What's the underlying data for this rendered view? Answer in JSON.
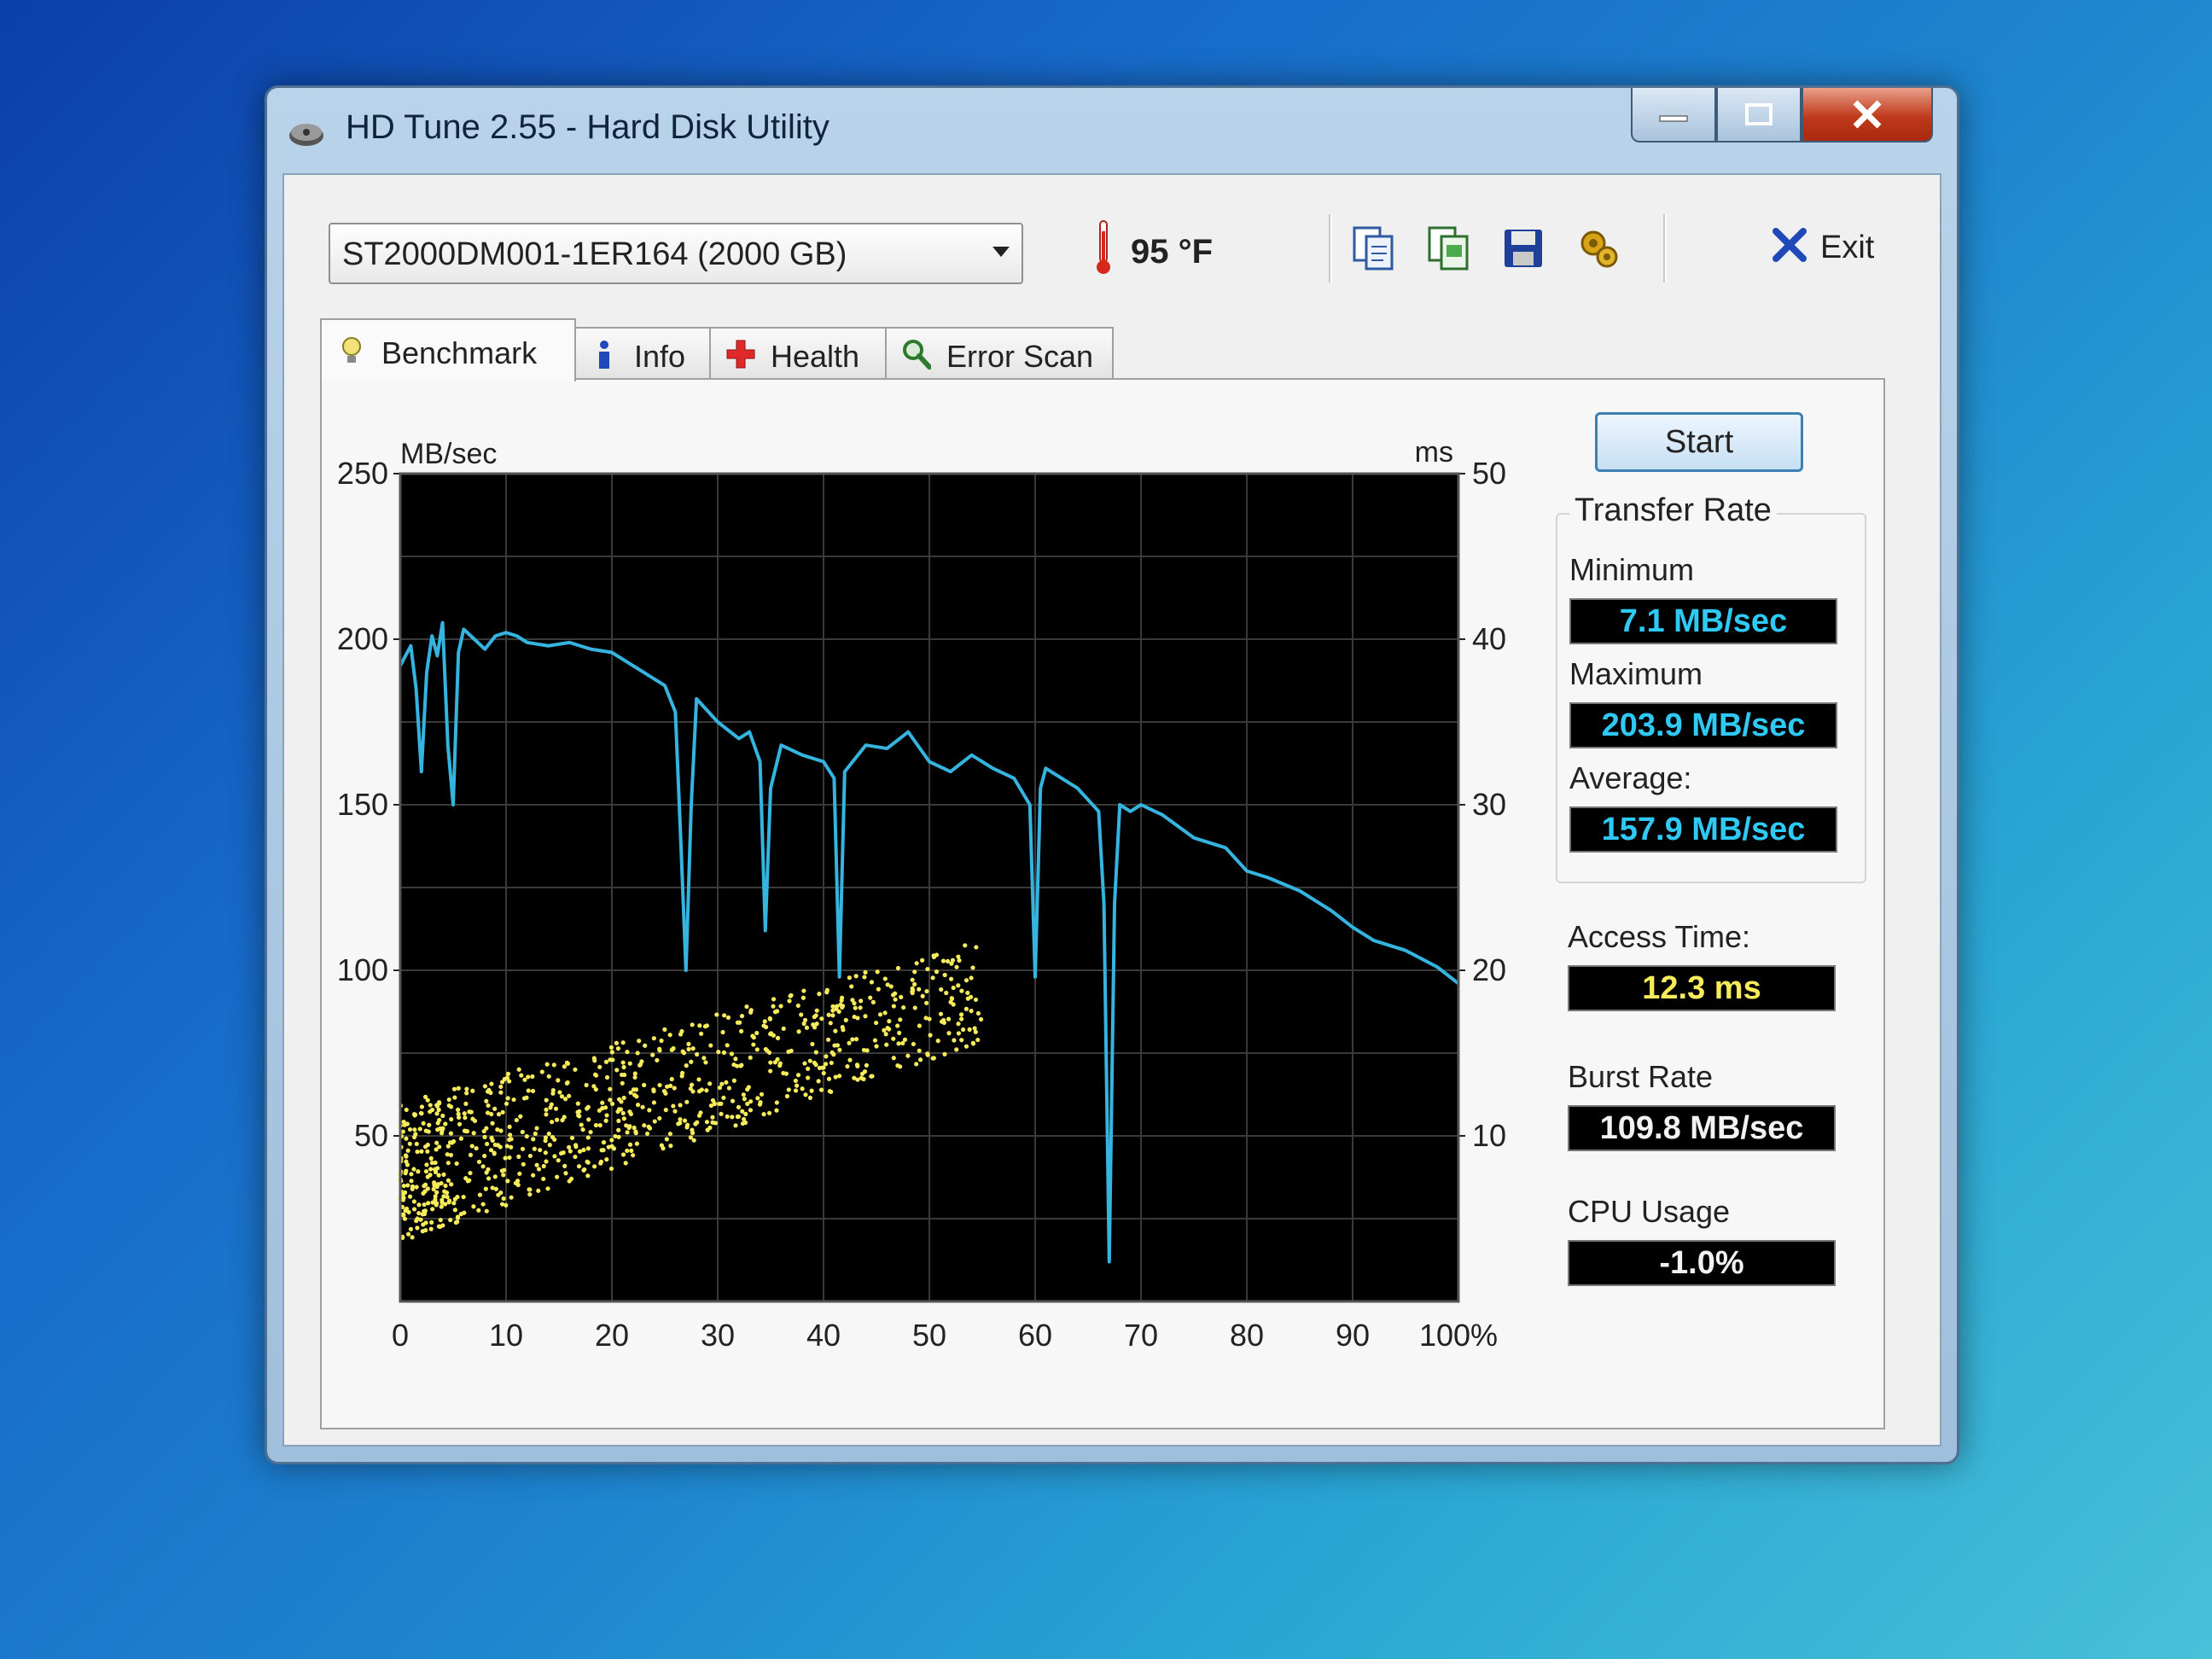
{
  "window": {
    "title": "HD Tune 2.55 - Hard Disk Utility"
  },
  "toolbar": {
    "drive": "ST2000DM001-1ER164 (2000 GB)",
    "temperature": "95 °F",
    "icons": [
      "copy-text-icon",
      "copy-screenshot-icon",
      "save-icon",
      "options-icon"
    ],
    "exit_label": "Exit"
  },
  "tabs": [
    {
      "label": "Benchmark",
      "icon": "lightbulb-icon",
      "active": true
    },
    {
      "label": "Info",
      "icon": "info-icon",
      "active": false
    },
    {
      "label": "Health",
      "icon": "health-cross-icon",
      "active": false
    },
    {
      "label": "Error Scan",
      "icon": "magnifier-icon",
      "active": false
    }
  ],
  "colors": {
    "transfer_line": "#35b4e0",
    "access_points": "#f6ec5b",
    "plot_bg": "#000000",
    "grid": "#3a3a3a"
  },
  "side": {
    "start_label": "Start",
    "transfer_rate_title": "Transfer Rate",
    "minimum_label": "Minimum",
    "minimum_value": "7.1 MB/sec",
    "maximum_label": "Maximum",
    "maximum_value": "203.9 MB/sec",
    "average_label": "Average:",
    "average_value": "157.9 MB/sec",
    "access_time_label": "Access Time:",
    "access_time_value": "12.3 ms",
    "burst_rate_label": "Burst Rate",
    "burst_rate_value": "109.8 MB/sec",
    "cpu_usage_label": "CPU Usage",
    "cpu_usage_value": "-1.0%"
  },
  "chart_data": {
    "type": "line",
    "grid": true,
    "y_left_unit": "MB/sec",
    "y_right_unit": "ms",
    "ylim": [
      0,
      250
    ],
    "y2lim": [
      0,
      50
    ],
    "y_ticks": [
      "250",
      "200",
      "150",
      "100",
      "50"
    ],
    "y2_ticks": [
      "50",
      "40",
      "30",
      "20",
      "10"
    ],
    "x_ticks": [
      "0",
      "10",
      "20",
      "30",
      "40",
      "50",
      "60",
      "70",
      "80",
      "90",
      "100%"
    ],
    "transfer_rate": {
      "x": [
        0,
        1,
        1.5,
        2,
        2.5,
        3,
        3.5,
        4,
        4.5,
        5,
        5.5,
        6,
        7,
        8,
        9,
        10,
        11,
        12,
        14,
        16,
        18,
        20,
        22,
        24,
        25,
        26,
        26.5,
        27,
        27.5,
        28,
        30,
        32,
        33,
        34,
        34.5,
        35,
        36,
        38,
        40,
        41,
        41.5,
        42,
        44,
        46,
        48,
        50,
        52,
        54,
        56,
        58,
        59.5,
        60,
        60.5,
        61,
        64,
        66,
        66.5,
        67,
        67.5,
        68,
        69,
        70,
        72,
        75,
        78,
        80,
        82,
        85,
        88,
        90,
        92,
        95,
        98,
        100
      ],
      "y": [
        192,
        198,
        185,
        160,
        190,
        201,
        195,
        205,
        168,
        150,
        196,
        203,
        200,
        197,
        201,
        202,
        201,
        199,
        198,
        199,
        197,
        196,
        192,
        188,
        186,
        178,
        140,
        100,
        150,
        182,
        175,
        170,
        172,
        163,
        112,
        155,
        168,
        165,
        163,
        158,
        98,
        160,
        168,
        167,
        172,
        163,
        160,
        165,
        161,
        158,
        150,
        98,
        155,
        161,
        155,
        148,
        120,
        12,
        120,
        150,
        148,
        150,
        147,
        140,
        137,
        130,
        128,
        124,
        118,
        113,
        109,
        106,
        101,
        96
      ]
    }
  }
}
